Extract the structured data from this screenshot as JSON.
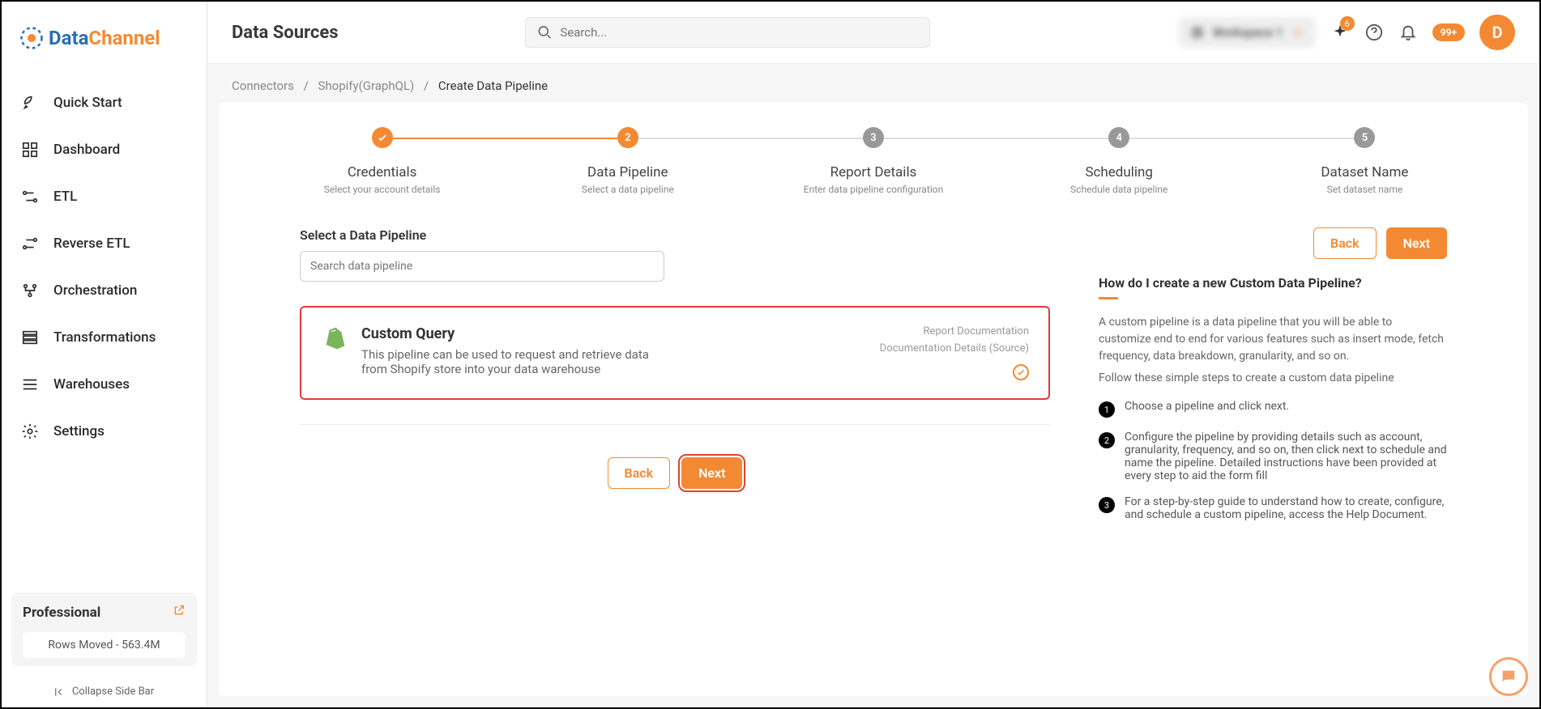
{
  "brand": {
    "part1": "Data",
    "part2": "Channel"
  },
  "header": {
    "title": "Data Sources",
    "search_placeholder": "Search...",
    "workspace": "Workspace 1",
    "sparkle_badge": "6",
    "notif_badge": "99+",
    "avatar_letter": "D"
  },
  "breadcrumbs": {
    "a": "Connectors",
    "b": "Shopify(GraphQL)",
    "c": "Create Data Pipeline"
  },
  "sidebar": {
    "items": [
      {
        "label": "Quick Start"
      },
      {
        "label": "Dashboard"
      },
      {
        "label": "ETL"
      },
      {
        "label": "Reverse ETL"
      },
      {
        "label": "Orchestration"
      },
      {
        "label": "Transformations"
      },
      {
        "label": "Warehouses"
      },
      {
        "label": "Settings"
      }
    ],
    "plan": {
      "name": "Professional",
      "rows": "Rows Moved - 563.4M"
    },
    "collapse": "Collapse Side Bar"
  },
  "stepper": [
    {
      "title": "Credentials",
      "sub": "Select your account details",
      "num": "✓",
      "state": "done"
    },
    {
      "title": "Data Pipeline",
      "sub": "Select a data pipeline",
      "num": "2",
      "state": "active"
    },
    {
      "title": "Report Details",
      "sub": "Enter data pipeline configuration",
      "num": "3",
      "state": "pending"
    },
    {
      "title": "Scheduling",
      "sub": "Schedule data pipeline",
      "num": "4",
      "state": "pending"
    },
    {
      "title": "Dataset Name",
      "sub": "Set dataset name",
      "num": "5",
      "state": "pending"
    }
  ],
  "pane": {
    "section_label": "Select a Data Pipeline",
    "search_placeholder": "Search data pipeline",
    "back": "Back",
    "next": "Next"
  },
  "card": {
    "title": "Custom Query",
    "desc": "This pipeline can be used to request and retrieve data from Shopify store into your data warehouse",
    "link1": "Report Documentation",
    "link2": "Documentation Details (Source)"
  },
  "help": {
    "title": "How do I create a new Custom Data Pipeline?",
    "p1": "A custom pipeline is a data pipeline that you will be able to customize end to end for various features such as insert mode, fetch frequency, data breakdown, granularity, and so on.",
    "p2": "Follow these simple steps to create a custom data pipeline",
    "steps": [
      "Choose a pipeline and click next.",
      "Configure the pipeline by providing details such as account, granularity, frequency, and so on, then click next to schedule and name the pipeline. Detailed instructions have been provided at every step to aid the form fill",
      "For a step-by-step guide to understand how to create, configure, and schedule a custom pipeline, access the Help Document."
    ]
  }
}
